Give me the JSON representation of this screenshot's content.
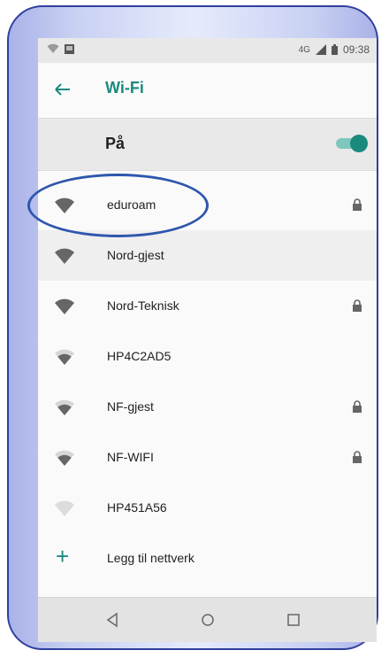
{
  "status_bar": {
    "network": "4G",
    "time": "09:38",
    "left_icons": [
      "wifi-off-icon",
      "image-icon"
    ],
    "right_icons": [
      "signal-icon",
      "battery-icon"
    ]
  },
  "header": {
    "back_icon": "arrow-left-icon",
    "title": "Wi-Fi"
  },
  "master_switch": {
    "label": "På",
    "state": "on"
  },
  "networks": [
    {
      "name": "eduroam",
      "secured": true,
      "signal": "strong"
    },
    {
      "name": "Nord-gjest",
      "secured": false,
      "signal": "strong"
    },
    {
      "name": "Nord-Teknisk",
      "secured": true,
      "signal": "strong"
    },
    {
      "name": "HP4C2AD5",
      "secured": false,
      "signal": "medium"
    },
    {
      "name": "NF-gjest",
      "secured": true,
      "signal": "medium"
    },
    {
      "name": "NF-WIFI",
      "secured": true,
      "signal": "medium"
    },
    {
      "name": "HP451A56",
      "secured": false,
      "signal": "weak"
    }
  ],
  "add_network": {
    "icon": "plus-icon",
    "label": "Legg til nettverk"
  },
  "nav_bar": {
    "buttons": [
      "back-triangle-icon",
      "home-circle-icon",
      "recents-square-icon"
    ]
  },
  "colors": {
    "accent": "#1a8a7d",
    "annotation": "#2e56ad",
    "frame": "#2f3f9e"
  }
}
